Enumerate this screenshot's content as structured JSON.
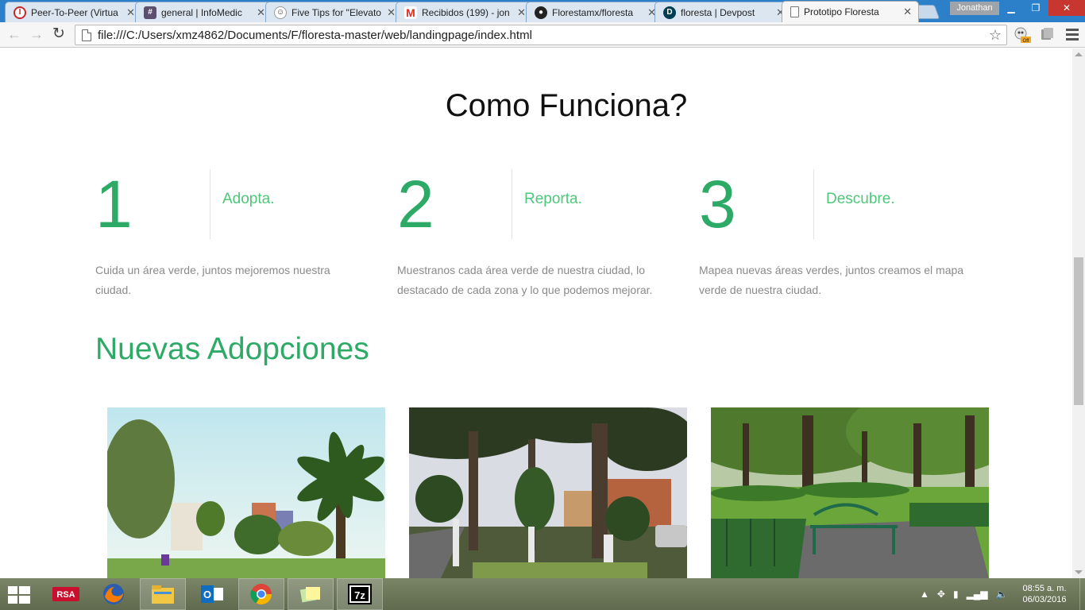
{
  "browser": {
    "tabs": [
      {
        "label": "Peer-To-Peer (Virtua",
        "favicon": "info-icon",
        "color": "#c62828",
        "active": false
      },
      {
        "label": "general | InfoMedic",
        "favicon": "hash-icon",
        "color": "#5d4d6e",
        "active": false
      },
      {
        "label": "Five Tips for \"Elevato",
        "favicon": "reddit-icon",
        "color": "#ff4500",
        "active": false
      },
      {
        "label": "Recibidos (199) - jon",
        "favicon": "gmail-icon",
        "color": "#d93025",
        "active": false
      },
      {
        "label": "Florestamx/floresta",
        "favicon": "github-icon",
        "color": "#222222",
        "active": false
      },
      {
        "label": "floresta | Devpost",
        "favicon": "devpost-icon",
        "color": "#003e54",
        "active": false
      },
      {
        "label": "Prototipo Floresta",
        "favicon": "page-icon",
        "color": "#777777",
        "active": true
      }
    ],
    "profile_name": "Jonathan",
    "url": "file:///C:/Users/xmz4862/Documents/F/floresta-master/web/landingpage/index.html"
  },
  "page": {
    "section_title": "Como Funciona?",
    "steps": [
      {
        "number": "1",
        "label": "Adopta.",
        "description": "Cuida un área verde, juntos mejoremos nuestra ciudad."
      },
      {
        "number": "2",
        "label": "Reporta.",
        "description": "Muestranos cada área verde de nuestra ciudad, lo destacado de cada zona y lo que podemos mejorar."
      },
      {
        "number": "3",
        "label": "Descubre.",
        "description": "Mapea nuevas áreas verdes, juntos creamos el mapa verde de nuestra ciudad."
      }
    ],
    "adoptions_title": "Nuevas Adopciones",
    "accent_color": "#2eaa67",
    "label_color": "#4dc77a"
  },
  "taskbar": {
    "apps": [
      "rsa-icon",
      "firefox-icon",
      "file-explorer-icon",
      "outlook-icon",
      "chrome-icon",
      "sticky-notes-icon",
      "7zip-icon"
    ],
    "time": "08:55 a. m.",
    "date": "06/03/2016"
  }
}
